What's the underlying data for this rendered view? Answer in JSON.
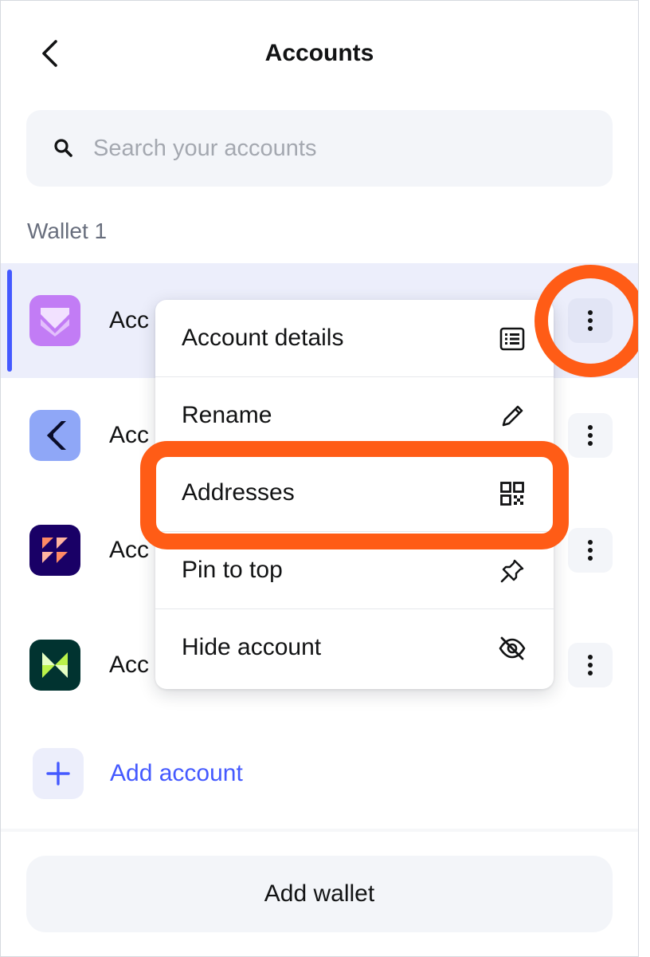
{
  "header": {
    "title": "Accounts"
  },
  "search": {
    "placeholder": "Search your accounts",
    "value": ""
  },
  "wallet": {
    "label": "Wallet 1"
  },
  "accounts": [
    {
      "name": "Acc",
      "avatar_color": "#c27cf5",
      "selected": true
    },
    {
      "name": "Acc",
      "avatar_color": "#8fa7f7",
      "selected": false
    },
    {
      "name": "Acc",
      "avatar_color": "#190066",
      "selected": false
    },
    {
      "name": "Acc",
      "avatar_color": "#013330",
      "selected": false
    }
  ],
  "add_account": {
    "label": "Add account"
  },
  "add_wallet": {
    "label": "Add wallet"
  },
  "menu": {
    "items": [
      {
        "label": "Account details",
        "icon": "list-icon"
      },
      {
        "label": "Rename",
        "icon": "pencil-icon"
      },
      {
        "label": "Addresses",
        "icon": "qr-code-icon"
      },
      {
        "label": "Pin to top",
        "icon": "pin-icon"
      },
      {
        "label": "Hide account",
        "icon": "eye-slash-icon"
      }
    ]
  },
  "colors": {
    "accent": "#4459ff",
    "annotation": "#ff5c16",
    "surface": "#f3f5f9",
    "selected_row": "#eceefb"
  }
}
